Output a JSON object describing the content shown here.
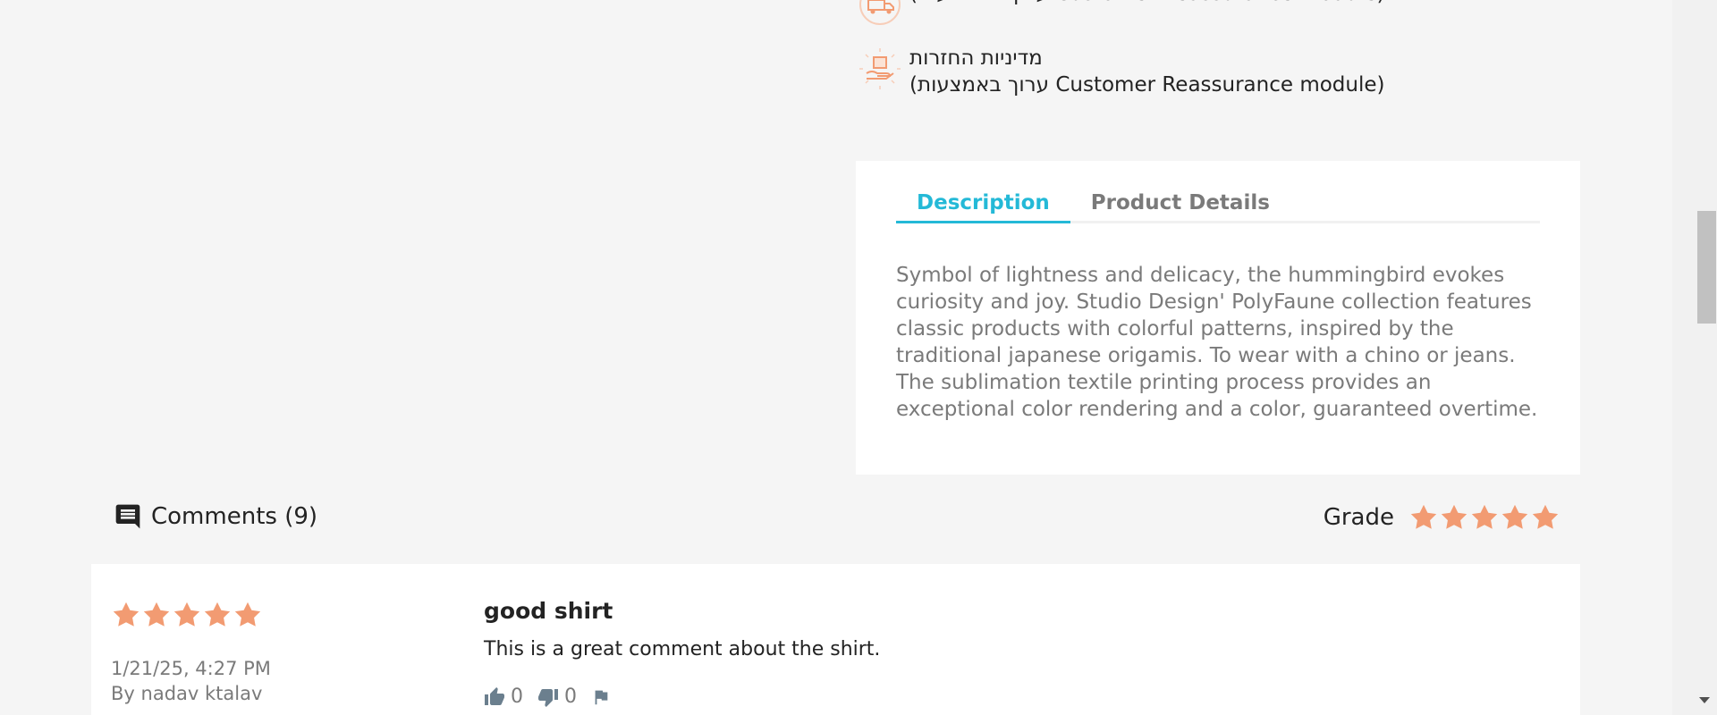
{
  "reassurance": [
    {
      "title": "",
      "sub": "(ערוך באמצעות Customer Reassurance module)",
      "icon": "shipping-icon"
    },
    {
      "title": "מדיניות החזרות",
      "sub": "(ערוך באמצעות Customer Reassurance module)",
      "icon": "returns-icon"
    }
  ],
  "tabs": [
    {
      "label": "Description",
      "active": true
    },
    {
      "label": "Product Details",
      "active": false
    }
  ],
  "description": "Symbol of lightness and delicacy, the hummingbird evokes curiosity and joy. Studio Design' PolyFaune collection features classic products with colorful patterns, inspired by the traditional japanese origamis. To wear with a chino or jeans. The sublimation textile printing process provides an exceptional color rendering and a color, guaranteed overtime.",
  "comments": {
    "title": "Comments (9)",
    "grade_label": "Grade",
    "grade_stars": 5,
    "items": [
      {
        "rating": 5,
        "date": "1/21/25, 4:27 PM",
        "author": "By nadav ktalav",
        "title": "good shirt",
        "body": "This is a great comment about the shirt.",
        "likes": "0",
        "dislikes": "0"
      }
    ]
  },
  "colors": {
    "accent": "#24b9d7",
    "star": "#f29b72",
    "text": "#232323",
    "muted": "#7a7a7a"
  }
}
